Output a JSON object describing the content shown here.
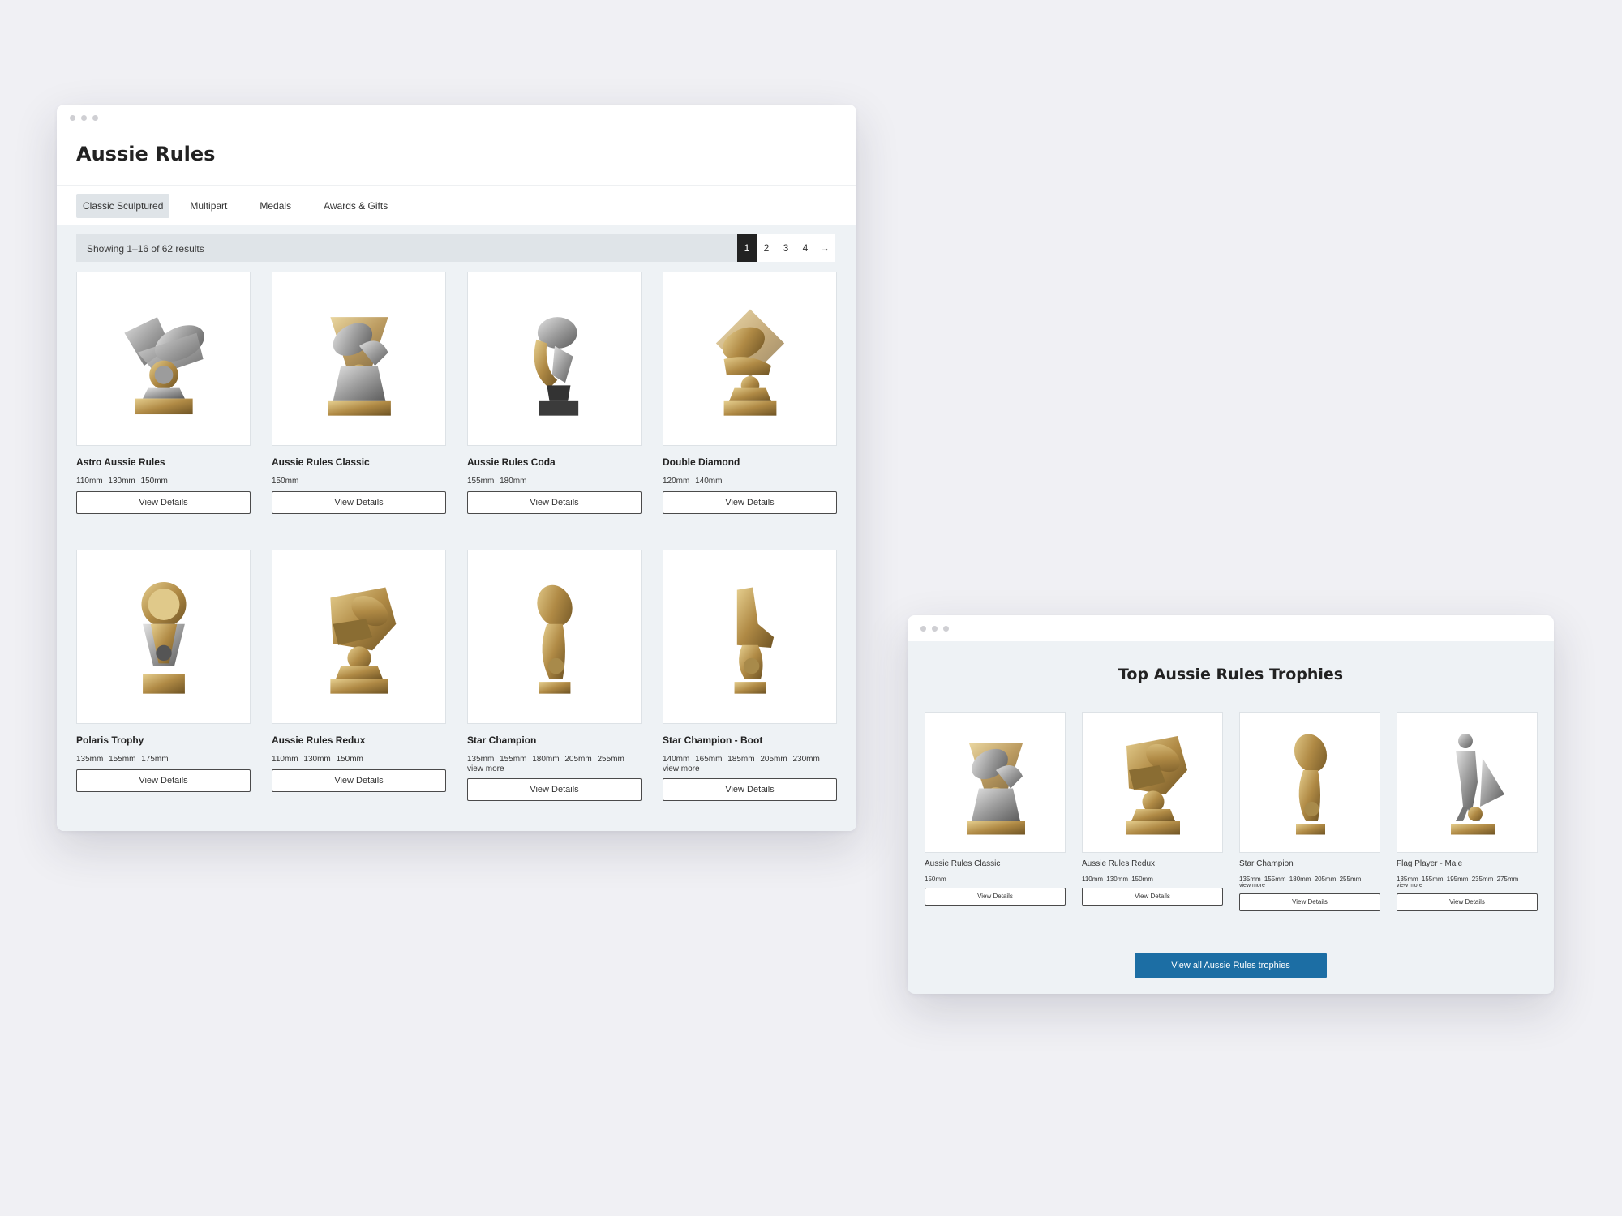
{
  "main_window": {
    "title": "Aussie Rules",
    "tabs": [
      "Classic Sculptured",
      "Multipart",
      "Medals",
      "Awards & Gifts"
    ],
    "active_tab": 0,
    "results_text": "Showing 1–16 of 62 results",
    "pagination": {
      "pages": [
        "1",
        "2",
        "3",
        "4"
      ],
      "current": "1",
      "next": "→"
    },
    "products": [
      {
        "name": "Astro Aussie Rules",
        "sizes": "110mm 130mm 150mm",
        "button": "View Details"
      },
      {
        "name": "Aussie Rules Classic",
        "sizes": "150mm",
        "button": "View Details"
      },
      {
        "name": "Aussie Rules Coda",
        "sizes": "155mm 180mm",
        "button": "View Details"
      },
      {
        "name": "Double Diamond",
        "sizes": "120mm 140mm",
        "button": "View Details"
      },
      {
        "name": "Polaris Trophy",
        "sizes": "135mm 155mm 175mm",
        "button": "View Details"
      },
      {
        "name": "Aussie Rules Redux",
        "sizes": "110mm 130mm 150mm",
        "button": "View Details"
      },
      {
        "name": "Star Champion",
        "sizes": "135mm 155mm 180mm 205mm 255mm",
        "more": "view more",
        "button": "View Details"
      },
      {
        "name": "Star Champion - Boot",
        "sizes": "140mm 165mm 185mm 205mm 230mm",
        "more": "view more",
        "button": "View Details"
      }
    ]
  },
  "top_window": {
    "title": "Top Aussie Rules Trophies",
    "products": [
      {
        "name": "Aussie Rules Classic",
        "sizes": "150mm",
        "button": "View Details"
      },
      {
        "name": "Aussie Rules Redux",
        "sizes": "110mm 130mm 150mm",
        "button": "View Details"
      },
      {
        "name": "Star Champion",
        "sizes": "135mm 155mm 180mm 205mm 255mm",
        "more": "view more",
        "button": "View Details"
      },
      {
        "name": "Flag Player - Male",
        "sizes": "135mm 155mm 195mm 235mm 275mm",
        "more": "view more",
        "button": "View Details"
      }
    ],
    "cta": "View all Aussie Rules trophies"
  },
  "colors": {
    "accent": "#1c6ea4",
    "page_bg": "#f0f0f4",
    "panel_bg": "#eef2f5",
    "gold": "#b08a45"
  },
  "icons": {
    "trophy": "trophy-icon",
    "next": "arrow-right-icon"
  }
}
